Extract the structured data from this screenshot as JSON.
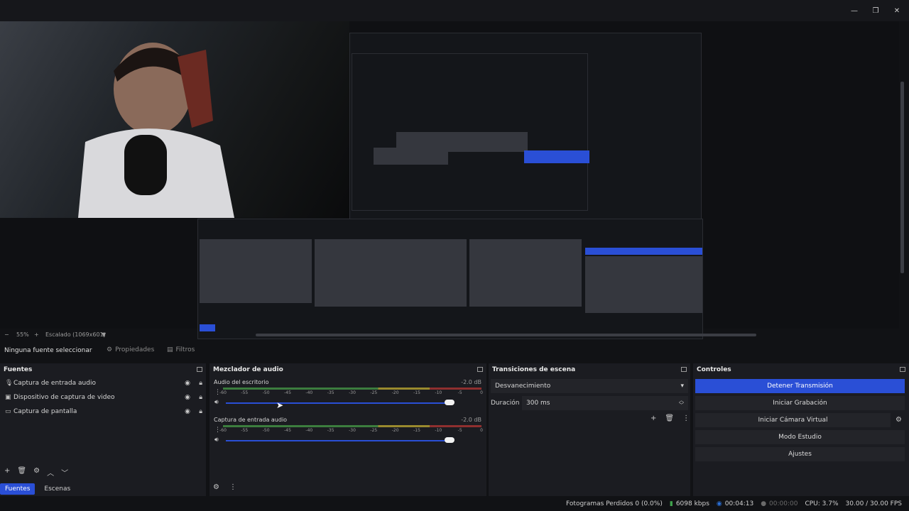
{
  "preview_bar": {
    "zoom": "55%",
    "scale": "Escalado (1069x601)"
  },
  "toolbar": {
    "no_source": "Ninguna fuente seleccionar",
    "properties": "Propiedades",
    "filters": "Filtros"
  },
  "sources": {
    "title": "Fuentes",
    "items": [
      {
        "label": "Captura de entrada audio",
        "icon": "microphone-icon"
      },
      {
        "label": "Dispositivo de captura de video",
        "icon": "camera-icon"
      },
      {
        "label": "Captura de pantalla",
        "icon": "monitor-icon"
      }
    ],
    "tabs": {
      "sources": "Fuentes",
      "scenes": "Escenas"
    }
  },
  "mixer": {
    "title": "Mezclador de audio",
    "channels": [
      {
        "name": "Audio del escritorio",
        "db": "-2.0 dB",
        "volume": 0.93
      },
      {
        "name": "Captura de entrada audio",
        "db": "-2.0 dB",
        "volume": 0.93
      }
    ],
    "ticks": [
      "-60",
      "-55",
      "-50",
      "-45",
      "-40",
      "-35",
      "-30",
      "-25",
      "-20",
      "-15",
      "-10",
      "-5",
      "0"
    ]
  },
  "transitions": {
    "title": "Transiciones de escena",
    "selected": "Desvanecimiento",
    "duration_label": "Duración",
    "duration_value": "300 ms"
  },
  "controls": {
    "title": "Controles",
    "stop_stream": "Detener Transmisión",
    "start_recording": "Iniciar Grabación",
    "start_virtual_cam": "Iniciar Cámara Virtual",
    "studio_mode": "Modo Estudio",
    "settings": "Ajustes"
  },
  "status": {
    "dropped": "Fotogramas Perdidos 0 (0.0%)",
    "bitrate": "6098 kbps",
    "stream_time": "00:04:13",
    "rec_time": "00:00:00",
    "cpu": "CPU: 3.7%",
    "fps": "30.00 / 30.00 FPS"
  },
  "colors": {
    "accent": "#2a4fd6",
    "panel": "#1b1c21",
    "bg": "#111215"
  }
}
